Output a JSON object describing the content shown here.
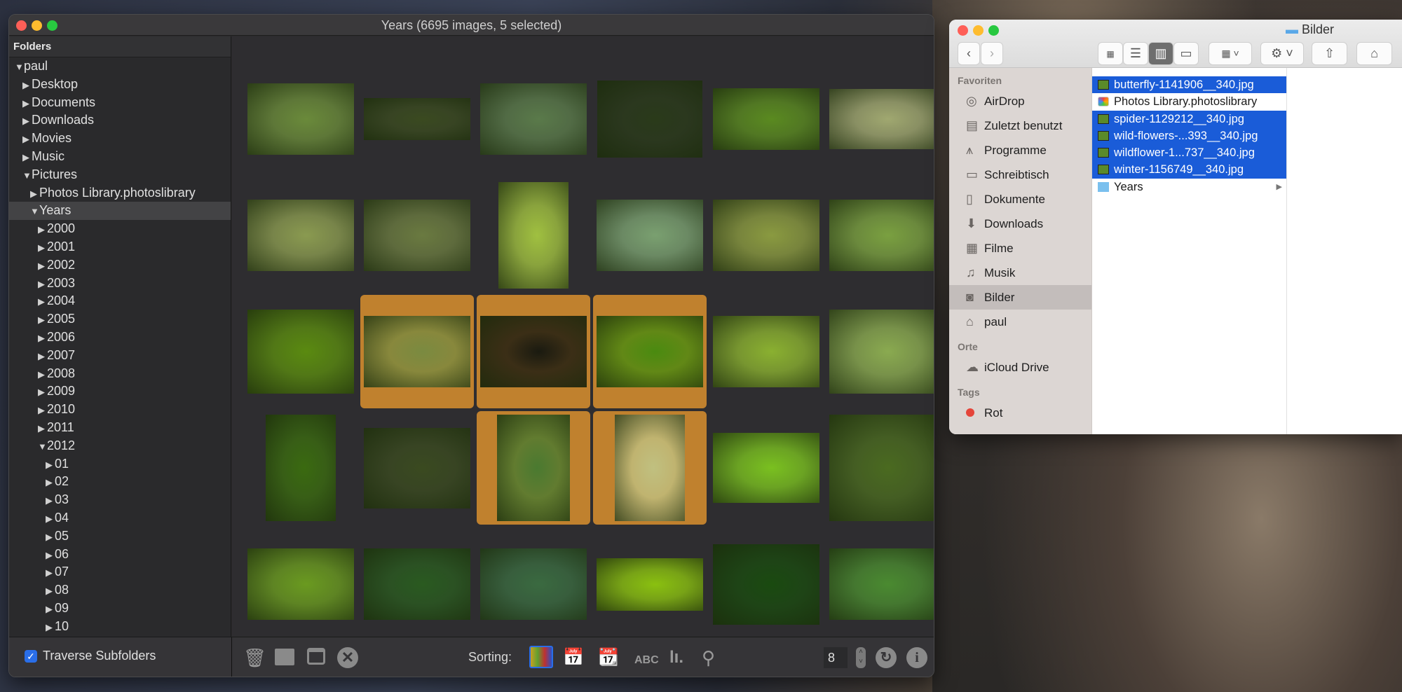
{
  "app": {
    "title": "Years (6695 images, 5 selected)"
  },
  "sidebar": {
    "header": "Folders",
    "tree": [
      {
        "label": "paul",
        "level": 0,
        "open": true
      },
      {
        "label": "Desktop",
        "level": 1
      },
      {
        "label": "Documents",
        "level": 1
      },
      {
        "label": "Downloads",
        "level": 1
      },
      {
        "label": "Movies",
        "level": 1
      },
      {
        "label": "Music",
        "level": 1
      },
      {
        "label": "Pictures",
        "level": 1,
        "open": true
      },
      {
        "label": "Photos Library.photoslibrary",
        "level": 2
      },
      {
        "label": "Years",
        "level": 2,
        "open": true,
        "selected": true
      },
      {
        "label": "2000",
        "level": 3
      },
      {
        "label": "2001",
        "level": 3
      },
      {
        "label": "2002",
        "level": 3
      },
      {
        "label": "2003",
        "level": 3
      },
      {
        "label": "2004",
        "level": 3
      },
      {
        "label": "2005",
        "level": 3
      },
      {
        "label": "2006",
        "level": 3
      },
      {
        "label": "2007",
        "level": 3
      },
      {
        "label": "2008",
        "level": 3
      },
      {
        "label": "2009",
        "level": 3
      },
      {
        "label": "2010",
        "level": 3
      },
      {
        "label": "2011",
        "level": 3
      },
      {
        "label": "2012",
        "level": 3,
        "open": true
      },
      {
        "label": "01",
        "level": 4
      },
      {
        "label": "02",
        "level": 4
      },
      {
        "label": "03",
        "level": 4
      },
      {
        "label": "04",
        "level": 4
      },
      {
        "label": "05",
        "level": 4
      },
      {
        "label": "06",
        "level": 4
      },
      {
        "label": "07",
        "level": 4
      },
      {
        "label": "08",
        "level": 4
      },
      {
        "label": "09",
        "level": 4
      },
      {
        "label": "10",
        "level": 4
      }
    ],
    "traverse_label": "Traverse Subfolders",
    "traverse_checked": true
  },
  "grid": {
    "selected_color": "#c0812e",
    "thumbnails": [
      {
        "selected": false
      },
      {
        "selected": false
      },
      {
        "selected": false
      },
      {
        "selected": false
      },
      {
        "selected": false
      },
      {
        "selected": false
      },
      {
        "selected": false
      },
      {
        "selected": false
      },
      {
        "selected": false
      },
      {
        "selected": false
      },
      {
        "selected": false
      },
      {
        "selected": false
      },
      {
        "selected": false
      },
      {
        "selected": true
      },
      {
        "selected": true
      },
      {
        "selected": true
      },
      {
        "selected": false
      },
      {
        "selected": false
      },
      {
        "selected": false
      },
      {
        "selected": false
      },
      {
        "selected": true
      },
      {
        "selected": true
      },
      {
        "selected": false
      },
      {
        "selected": false
      },
      {
        "selected": false
      },
      {
        "selected": false
      },
      {
        "selected": false
      },
      {
        "selected": false
      },
      {
        "selected": false
      },
      {
        "selected": false
      }
    ]
  },
  "toolbar": {
    "sorting_label": "Sorting:",
    "columns_value": "8",
    "icons": [
      "trash-icon",
      "folder-icon",
      "window-icon",
      "close-circle-icon"
    ],
    "sort_icons": [
      "color-sort-icon",
      "date-camera-icon",
      "date-edit-icon",
      "abc-sort-icon",
      "size-sort-icon",
      "search-icon"
    ]
  },
  "finder": {
    "title": "Bilder",
    "favorites_header": "Favoriten",
    "favorites": [
      {
        "label": "AirDrop",
        "icon": "airdrop-icon"
      },
      {
        "label": "Zuletzt benutzt",
        "icon": "recents-icon"
      },
      {
        "label": "Programme",
        "icon": "applications-icon"
      },
      {
        "label": "Schreibtisch",
        "icon": "desktop-icon"
      },
      {
        "label": "Dokumente",
        "icon": "document-icon"
      },
      {
        "label": "Downloads",
        "icon": "download-icon"
      },
      {
        "label": "Filme",
        "icon": "film-icon"
      },
      {
        "label": "Musik",
        "icon": "music-icon"
      },
      {
        "label": "Bilder",
        "icon": "camera-icon",
        "selected": true
      },
      {
        "label": "paul",
        "icon": "home-icon"
      }
    ],
    "places_header": "Orte",
    "places": [
      {
        "label": "iCloud Drive",
        "icon": "cloud-icon"
      }
    ],
    "tags_header": "Tags",
    "tags": [
      {
        "label": "Rot",
        "color": "#e5453a"
      }
    ],
    "files": [
      {
        "name": "butterfly-1141906__340.jpg",
        "selected": true
      },
      {
        "name": "Photos Library.photoslibrary",
        "selected": false
      },
      {
        "name": "spider-1129212__340.jpg",
        "selected": true
      },
      {
        "name": "wild-flowers-...393__340.jpg",
        "selected": true
      },
      {
        "name": "wildflower-1...737__340.jpg",
        "selected": true
      },
      {
        "name": "winter-1156749__340.jpg",
        "selected": true
      },
      {
        "name": "Years",
        "selected": false,
        "folder": true
      }
    ]
  }
}
